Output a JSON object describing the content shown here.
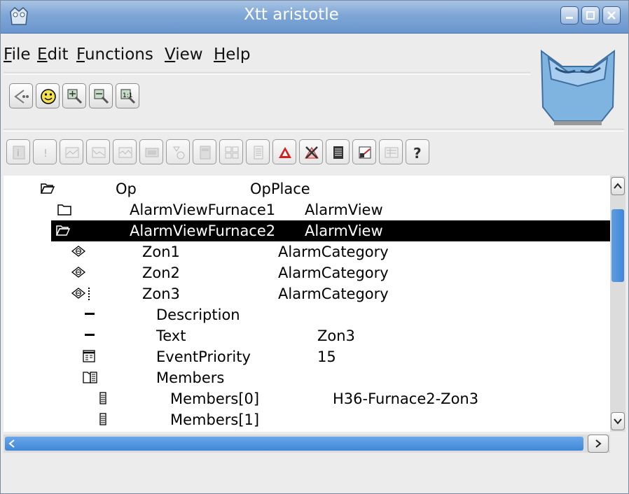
{
  "window": {
    "title": "Xtt aristotle"
  },
  "menubar": {
    "items": [
      {
        "key": "F",
        "rest": "ile"
      },
      {
        "key": "E",
        "rest": "dit"
      },
      {
        "key": "F",
        "rest": "unctions"
      },
      {
        "key": "V",
        "rest": "iew"
      },
      {
        "key": "H",
        "rest": "elp"
      }
    ]
  },
  "toolbar": {
    "icons": [
      "navigate-back-icon",
      "smiley-icon",
      "zoom-in-icon",
      "zoom-out-icon",
      "zoom-reset-icon"
    ]
  },
  "toolbar2": {
    "icons": [
      "info-icon",
      "alarm-icon",
      "trend-icon",
      "plot-icon",
      "fast-curve-icon",
      "graph-icon",
      "flow-icon",
      "open-object-icon",
      "crossref-icon",
      "history-icon",
      "event-icon",
      "block-icon",
      "classgraph-icon",
      "graph-scan-icon",
      "collect-icon",
      "help-icon"
    ],
    "accent": "#d02020"
  },
  "tree": {
    "rows": [
      {
        "icon": "folder-open-icon",
        "name": "Op",
        "class": "OpPlace",
        "selected": false
      },
      {
        "icon": "folder-icon",
        "name": "AlarmViewFurnace1",
        "class": "AlarmView",
        "selected": false
      },
      {
        "icon": "folder-open-icon",
        "name": "AlarmViewFurnace2",
        "class": "AlarmView",
        "selected": true
      },
      {
        "icon": "leaf-object-icon",
        "name": "Zon1",
        "class": "AlarmCategory",
        "selected": false
      },
      {
        "icon": "leaf-object-icon",
        "name": "Zon2",
        "class": "AlarmCategory",
        "selected": false
      },
      {
        "icon": "leaf-object-attr-icon",
        "name": "Zon3",
        "class": "AlarmCategory",
        "selected": false
      },
      {
        "icon": "attribute-icon",
        "name": "Description",
        "value": "",
        "selected": false
      },
      {
        "icon": "attribute-icon",
        "name": "Text",
        "value": "Zon3",
        "selected": false
      },
      {
        "icon": "enum-icon",
        "name": "EventPriority",
        "value": "15",
        "selected": false
      },
      {
        "icon": "array-icon",
        "name": "Members",
        "value": "",
        "selected": false
      },
      {
        "icon": "array-element-icon",
        "name": "Members[0]",
        "value": "H36-Furnace2-Zon3",
        "selected": false
      },
      {
        "icon": "array-element-icon",
        "name": "Members[1]",
        "value": "",
        "selected": false
      }
    ]
  },
  "colors": {
    "titlebar": "#7ea6d6",
    "selection": "#000000",
    "scroll": "#3f86d8"
  }
}
